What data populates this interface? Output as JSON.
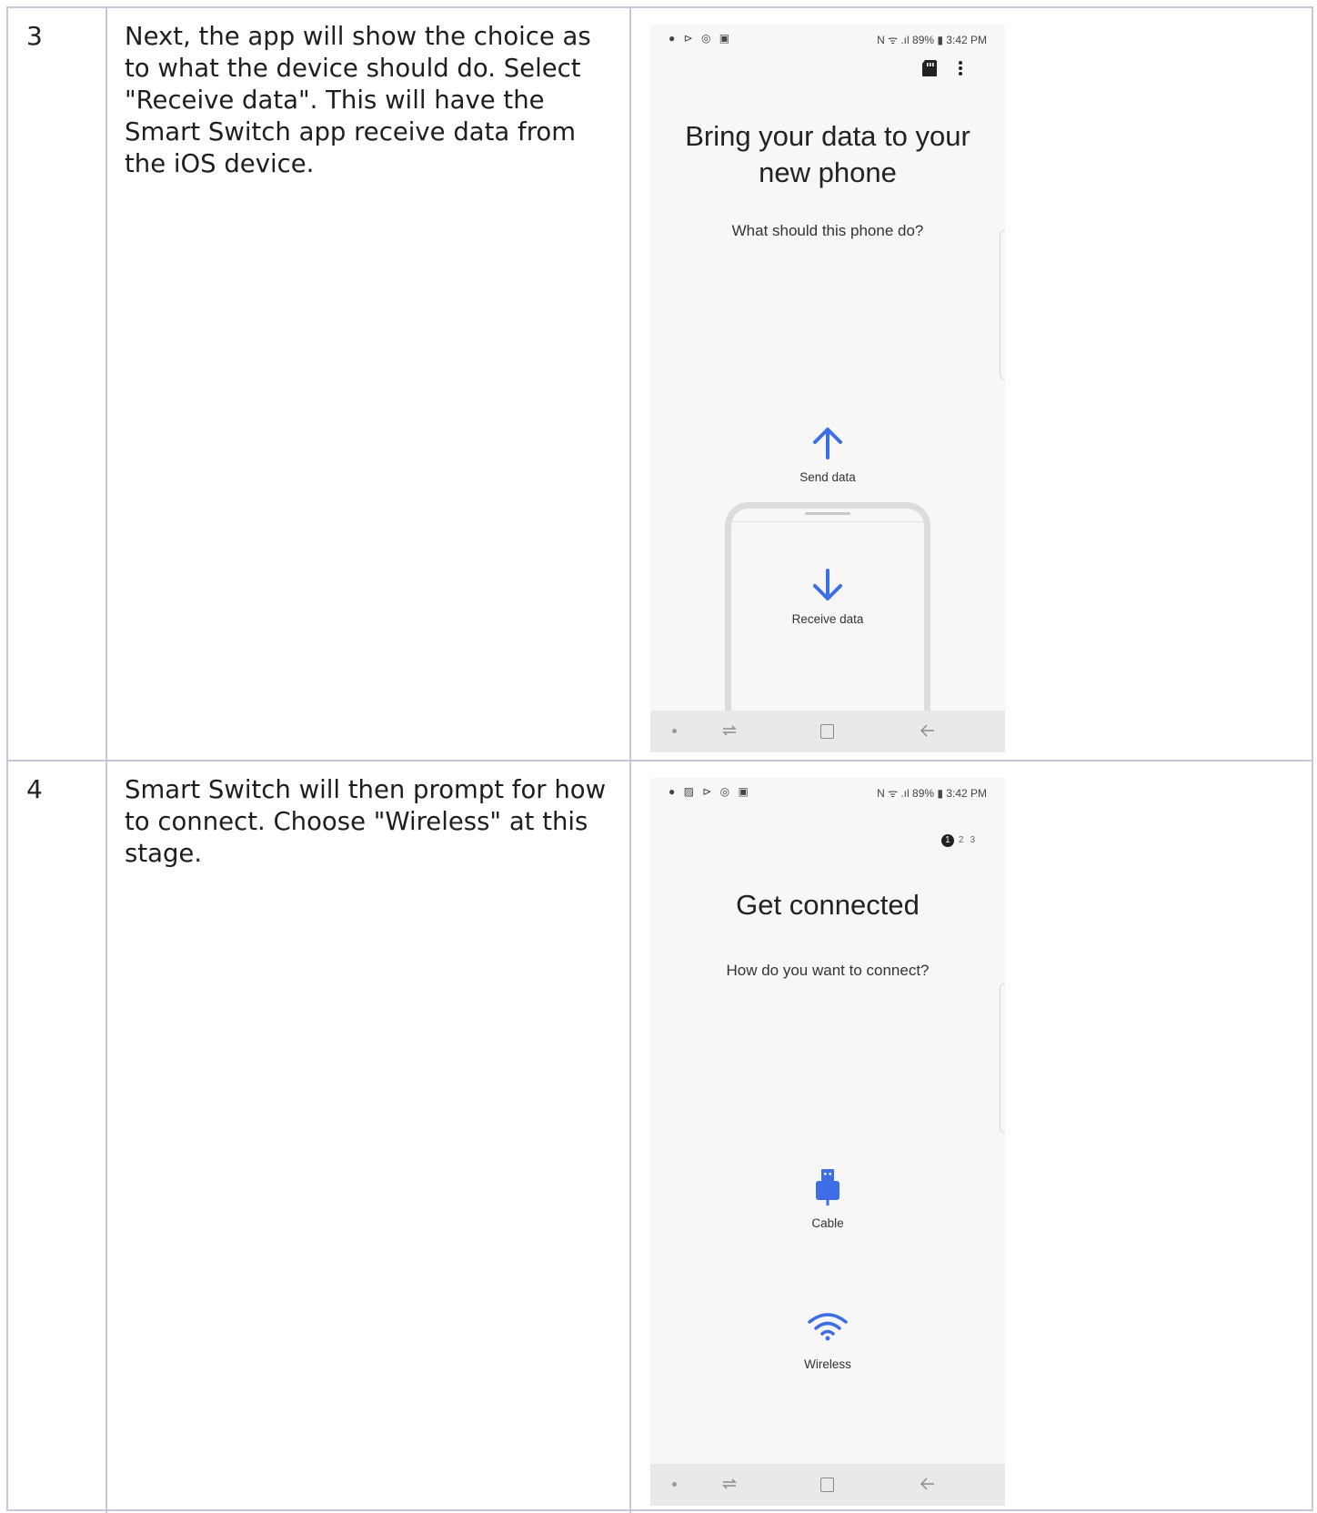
{
  "rows": [
    {
      "step": "3",
      "description": "Next, the app will show the choice as to what the device should do. Select \"Receive data\". This will have the Smart Switch app receive data from the iOS device.",
      "screen": {
        "status_icons_left": "● ⊳ ◎ ▣",
        "status_right": "N ᯤ .ıl 89% ▮ 3:42 PM",
        "title_line1": "Bring your data to your",
        "title_line2": "new phone",
        "subtitle": "What should this phone do?",
        "options": [
          {
            "label": "Send data",
            "icon": "arrow-up-icon"
          },
          {
            "label": "Receive data",
            "icon": "arrow-down-icon"
          }
        ]
      }
    },
    {
      "step": "4",
      "description": "Smart Switch will then prompt for how to connect. Choose \"Wireless\" at this stage.",
      "screen": {
        "status_icons_left": "● ▨ ⊳ ◎ ▣",
        "status_right": "N ᯤ .ıl 89% ▮ 3:42 PM",
        "steps": [
          "1",
          "2",
          "3"
        ],
        "title": "Get connected",
        "subtitle": "How do you want to connect?",
        "options": [
          {
            "label": "Cable",
            "icon": "usb-cable-icon"
          },
          {
            "label": "Wireless",
            "icon": "wifi-icon"
          }
        ]
      }
    }
  ],
  "colors": {
    "accent": "#3d6ee6",
    "border": "#c6c6dc"
  }
}
